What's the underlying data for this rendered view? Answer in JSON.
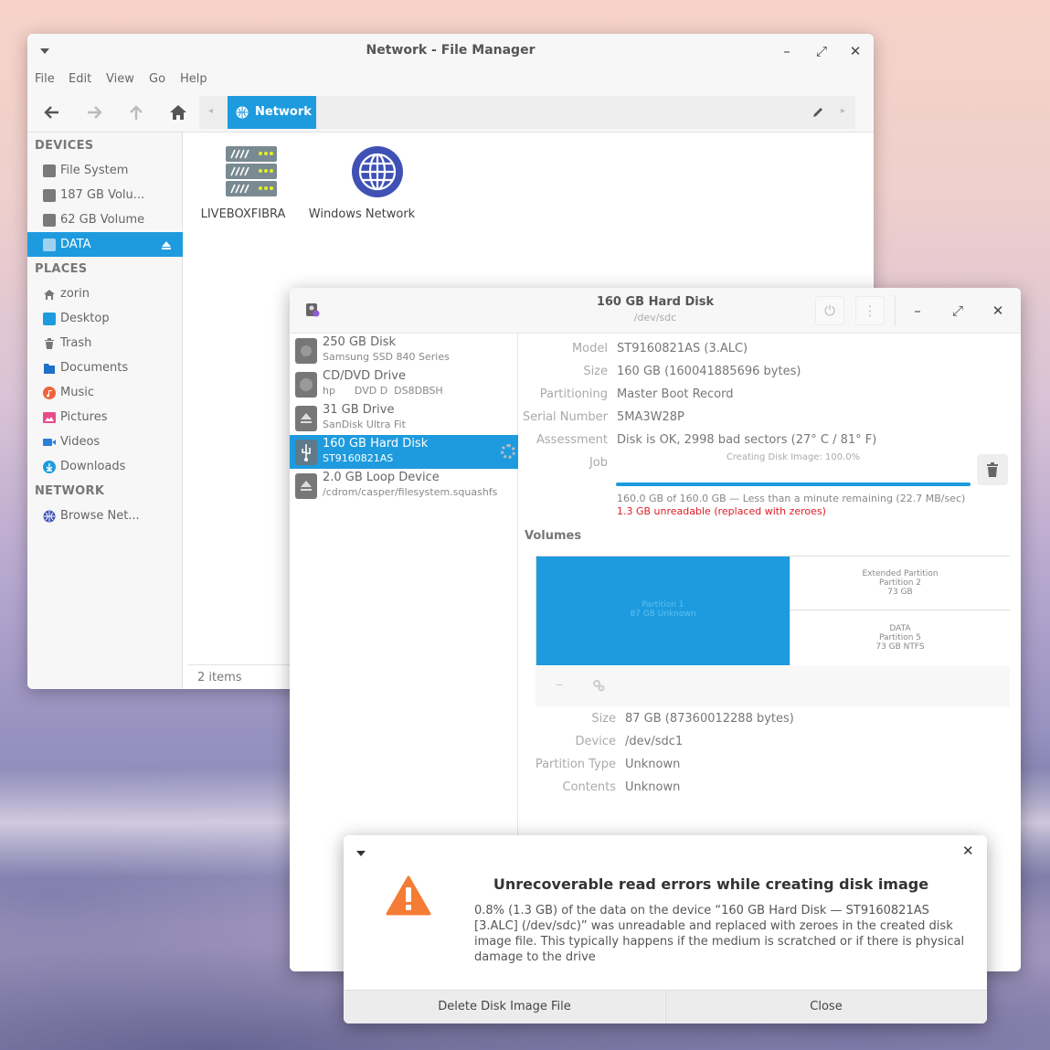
{
  "file_manager": {
    "title": "Network - File Manager",
    "menu": [
      "File",
      "Edit",
      "View",
      "Go",
      "Help"
    ],
    "path_segment": "Network",
    "sidebar": {
      "devices_heading": "DEVICES",
      "devices": [
        "File System",
        "187 GB Volu...",
        "62 GB Volume",
        "DATA"
      ],
      "places_heading": "PLACES",
      "places": [
        "zorin",
        "Desktop",
        "Trash",
        "Documents",
        "Music",
        "Pictures",
        "Videos",
        "Downloads"
      ],
      "network_heading": "NETWORK",
      "network": [
        "Browse Net..."
      ]
    },
    "items": [
      "LIVEBOXFIBRA",
      "Windows Network"
    ],
    "status": "2 items"
  },
  "disks": {
    "title": "160 GB Hard Disk",
    "subtitle": "/dev/sdc",
    "drives": [
      {
        "name": "250 GB Disk",
        "desc": "Samsung SSD 840 Series"
      },
      {
        "name": "CD/DVD Drive",
        "desc": "hp      DVD D  DS8DBSH"
      },
      {
        "name": "31 GB Drive",
        "desc": "SanDisk Ultra Fit"
      },
      {
        "name": "160 GB Hard Disk",
        "desc": "ST9160821AS"
      },
      {
        "name": "2.0 GB Loop Device",
        "desc": "/cdrom/casper/filesystem.squashfs"
      }
    ],
    "info": {
      "model_label": "Model",
      "model": "ST9160821AS (3.ALC)",
      "size_label": "Size",
      "size": "160 GB (160041885696 bytes)",
      "partitioning_label": "Partitioning",
      "partitioning": "Master Boot Record",
      "serial_label": "Serial Number",
      "serial": "5MA3W28P",
      "assessment_label": "Assessment",
      "assessment": "Disk is OK, 2998 bad sectors (27° C / 81° F)",
      "job_label": "Job",
      "job_title": "Creating Disk Image: 100.0%",
      "job_progress": 1.0,
      "job_status": "160.0 GB of 160.0 GB — Less than a minute remaining (22.7 MB/sec)",
      "job_error": "1.3 GB unreadable (replaced with zeroes)"
    },
    "volumes_heading": "Volumes",
    "volumes": {
      "p1_name": "Partition 1",
      "p1_desc": "87 GB Unknown",
      "ext_type": "Extended Partition",
      "ext_name": "Partition 2",
      "ext_size": "73 GB",
      "data_label": "DATA",
      "data_name": "Partition 5",
      "data_desc": "73 GB NTFS"
    },
    "selected_volume": {
      "size_label": "Size",
      "size": "87 GB (87360012288 bytes)",
      "device_label": "Device",
      "device": "/dev/sdc1",
      "ptype_label": "Partition Type",
      "ptype": "Unknown",
      "contents_label": "Contents",
      "contents": "Unknown"
    }
  },
  "dialog": {
    "title": "Unrecoverable read errors while creating disk image",
    "body": "0.8% (1.3 GB) of the data on the device “160 GB Hard Disk — ST9160821AS [3.ALC] (/dev/sdc)” was unreadable and replaced with zeroes in the created disk image file. This typically happens if the medium is scratched or if there is physical damage to the drive",
    "delete_label": "Delete Disk Image File",
    "close_label": "Close"
  },
  "colors": {
    "accent": "#1e9bde",
    "error": "#e01b24",
    "warning": "#f57c35"
  }
}
